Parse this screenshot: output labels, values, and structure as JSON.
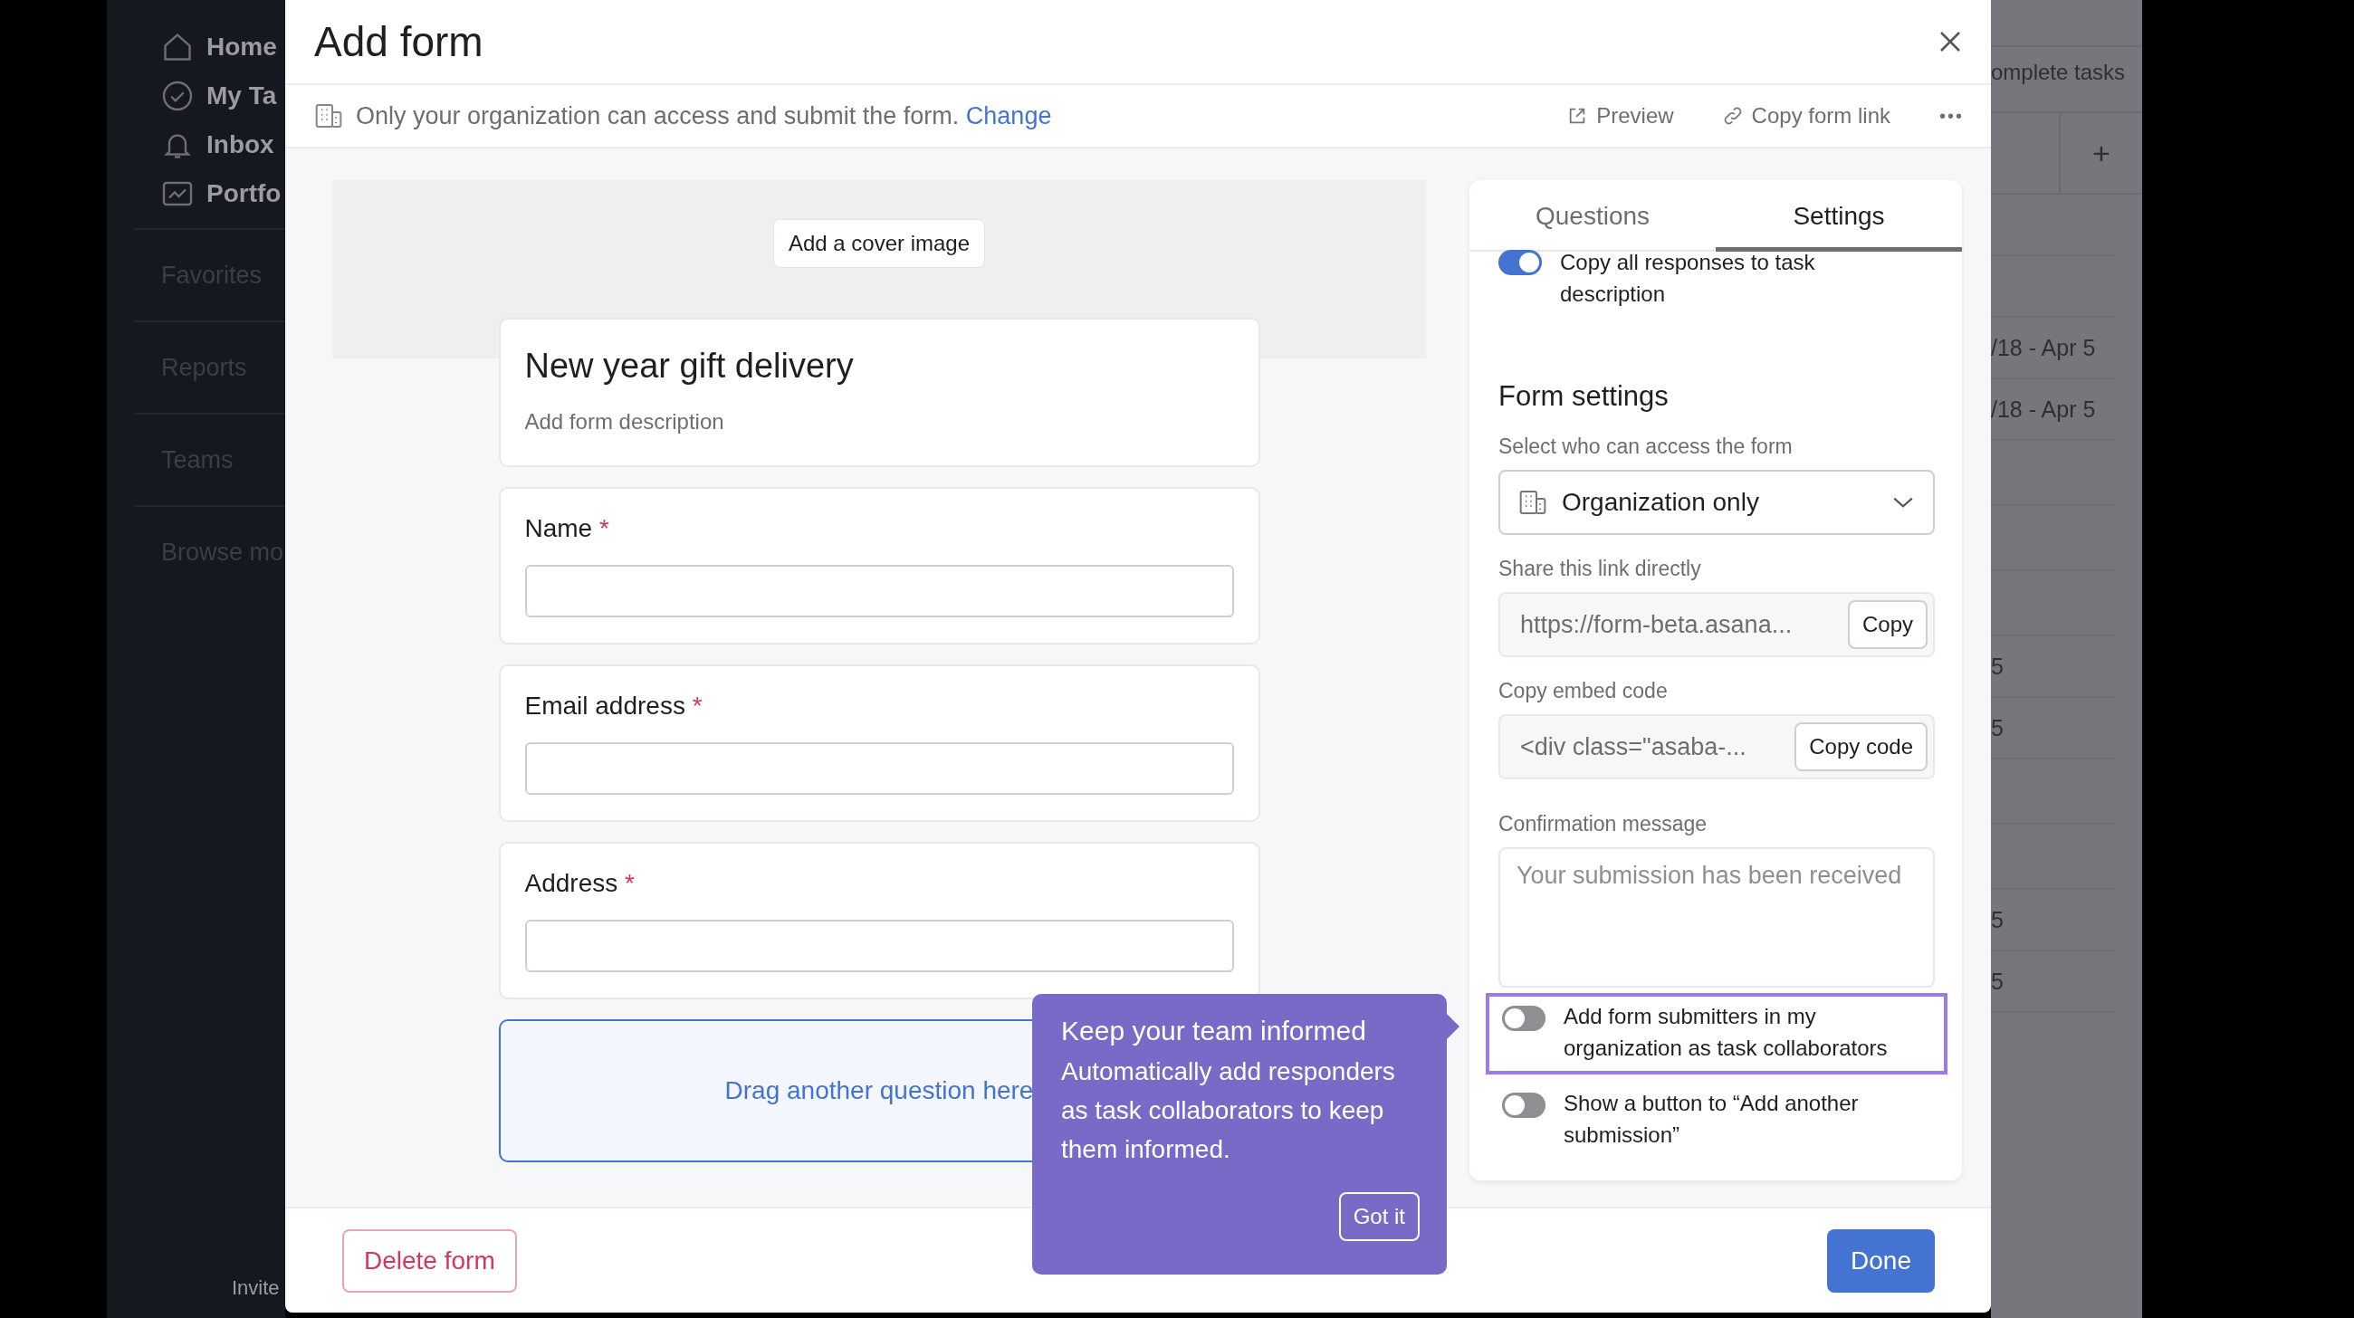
{
  "sidebar": {
    "nav_items": [
      {
        "label": "Home"
      },
      {
        "label": "My Ta"
      },
      {
        "label": "Inbox"
      },
      {
        "label": "Portfo"
      }
    ],
    "sections": [
      "Favorites",
      "Reports",
      "Teams",
      "Browse mo"
    ],
    "footer": "Invite"
  },
  "background": {
    "header": "omplete tasks",
    "add_column": "+",
    "cells": [
      {
        "text": "/18 - Apr 5"
      },
      {
        "text": "/18 - Apr 5"
      },
      {
        "text": "5"
      },
      {
        "text": "5"
      },
      {
        "text": "5"
      },
      {
        "text": "5"
      }
    ]
  },
  "dialog": {
    "title": "Add form",
    "access_notice": {
      "text": "Only your organization can access and submit the form.",
      "link": "Change"
    },
    "actions": [
      {
        "label": "Preview"
      },
      {
        "label": "Copy form link"
      }
    ],
    "more": "•••",
    "cover_button": "Add a cover image",
    "form": {
      "title": "New year gift delivery",
      "description_placeholder": "Add form description",
      "questions": [
        {
          "label": "Name",
          "required": true,
          "required_mark": "*"
        },
        {
          "label": "Email address",
          "required": true,
          "required_mark": "*"
        },
        {
          "label": "Address",
          "required": true,
          "required_mark": "*"
        }
      ],
      "drop_zone": "Drag another question here"
    },
    "tabs": [
      {
        "label": "Questions",
        "selected": false
      },
      {
        "label": "Settings",
        "selected": true
      }
    ],
    "settings": {
      "top_toggle": {
        "label": "Copy all responses to task description",
        "on": true
      },
      "heading": "Form settings",
      "access_label": "Select who can access the form",
      "access_value": "Organization only",
      "share_label": "Share this link directly",
      "share_value": "https://form-beta.asana...",
      "share_button": "Copy",
      "embed_label": "Copy embed code",
      "embed_value": "<div class=\"asaba-...",
      "embed_button": "Copy code",
      "confirmation_label": "Confirmation message",
      "confirmation_placeholder": "Your submission has been received",
      "toggles": [
        {
          "label": "Add form submitters in my organization as task collaborators",
          "on": false,
          "highlighted": true
        },
        {
          "label": "Show a button to “Add another submission”",
          "on": false,
          "highlighted": false
        }
      ]
    },
    "tooltip": {
      "title": "Keep your team informed",
      "body": "Automatically add responders as task collaborators to keep them informed.",
      "button": "Got it"
    },
    "delete_button": "Delete form",
    "done_button": "Done"
  }
}
